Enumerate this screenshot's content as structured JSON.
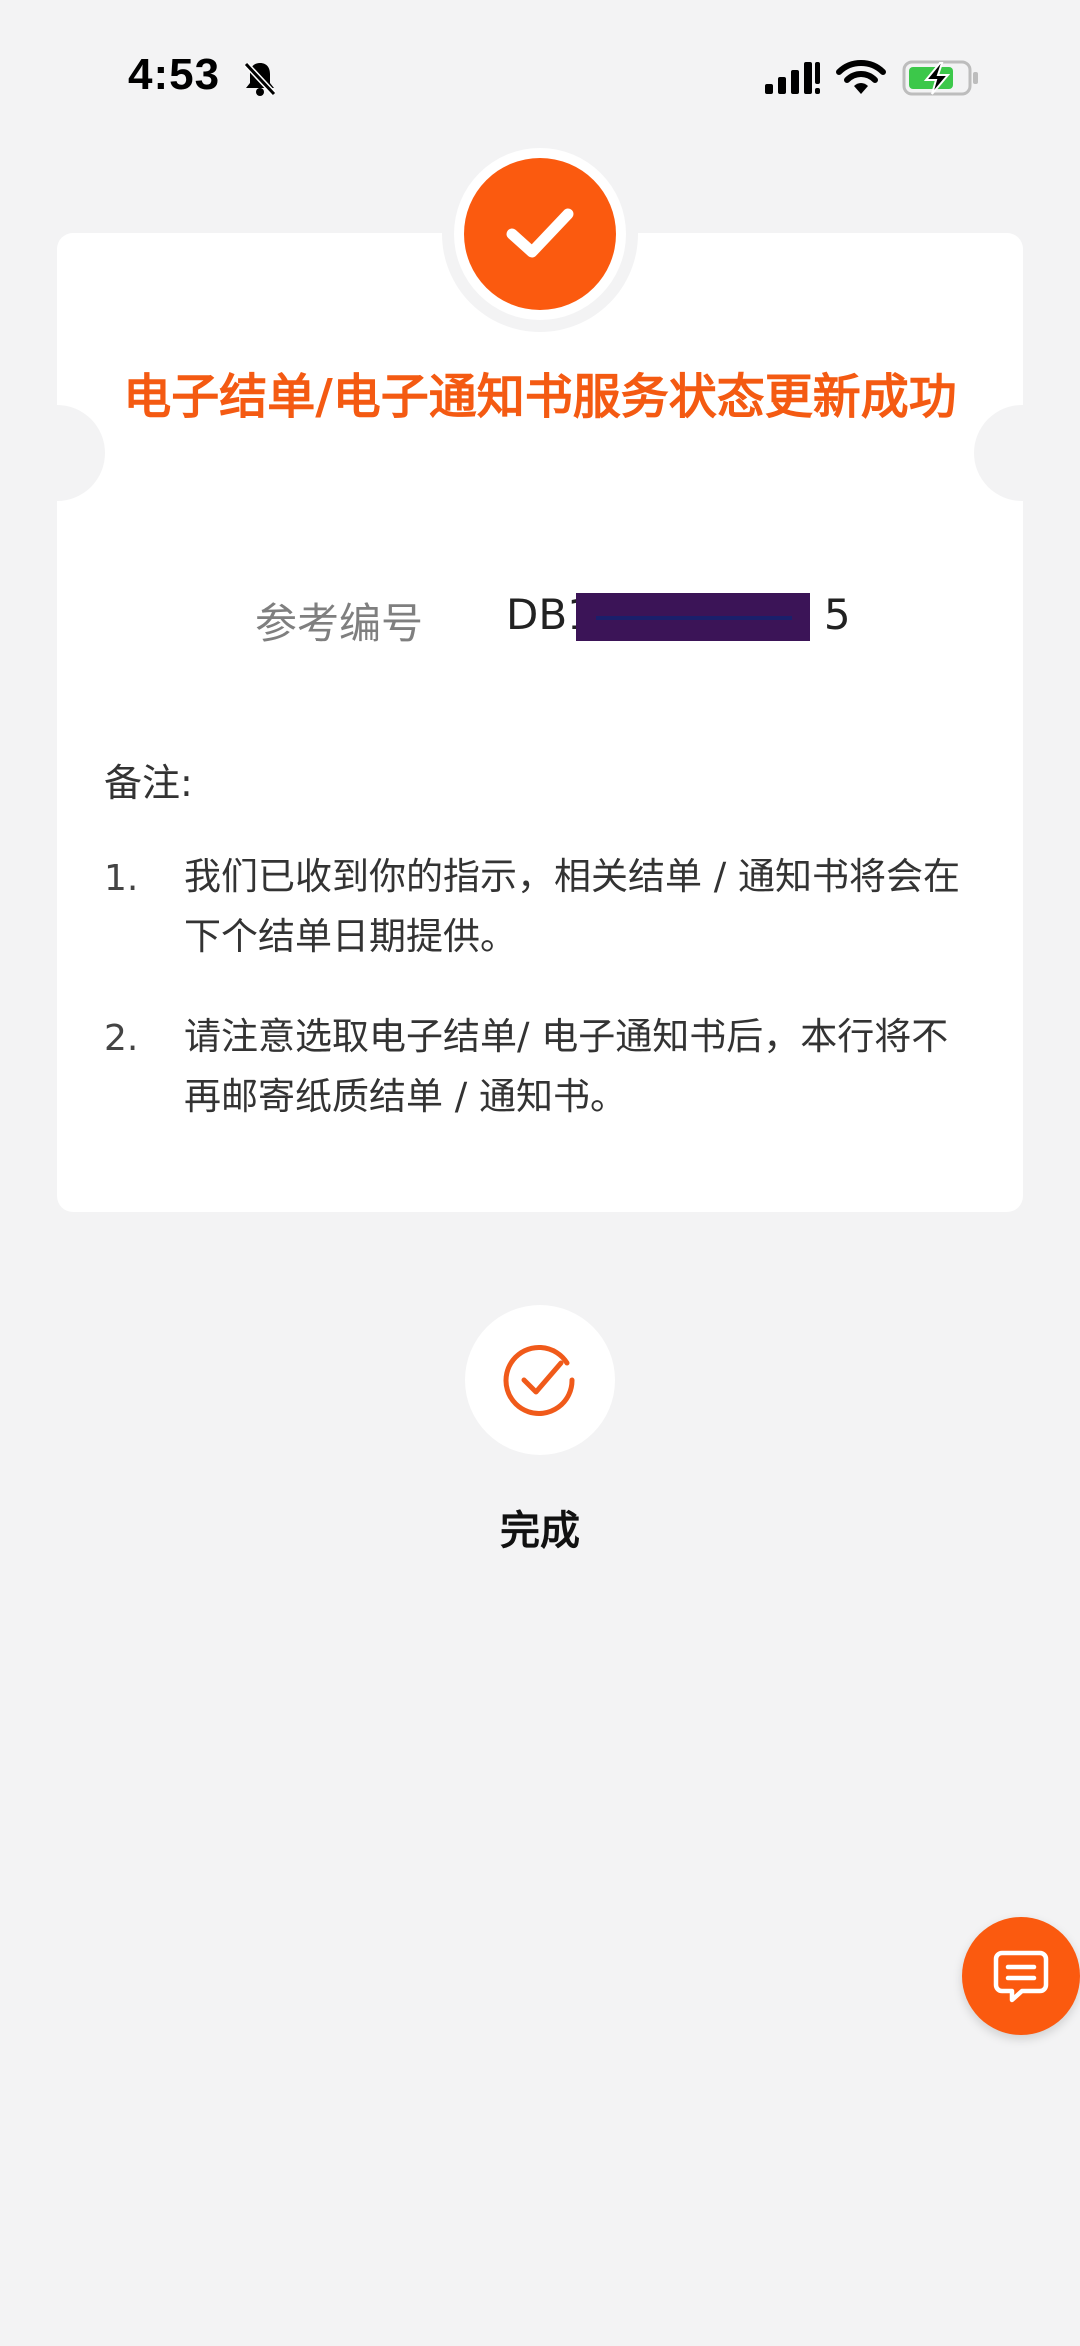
{
  "status_bar": {
    "time": "4:53"
  },
  "colors": {
    "accent": "#fb5a0f",
    "title": "#f45a12",
    "background": "#f3f3f4"
  },
  "card": {
    "title": "电子结单/电子通知书服务状态更新成功",
    "reference_label": "参考编号",
    "reference_value_start": "DB1",
    "reference_value_end": "5",
    "remarks_label": "备注:",
    "remarks": [
      {
        "num": "1.",
        "text": "我们已收到你的指示，相关结单 / 通知书将会在下个结单日期提供。"
      },
      {
        "num": "2.",
        "text": "请注意选取电子结单/ 电子通知书后，本行将不再邮寄纸质结单 / 通知书。"
      }
    ]
  },
  "done": {
    "label": "完成"
  },
  "icons": {
    "success": "check-icon",
    "done": "circle-check-icon",
    "chat": "chat-bubble-icon"
  }
}
